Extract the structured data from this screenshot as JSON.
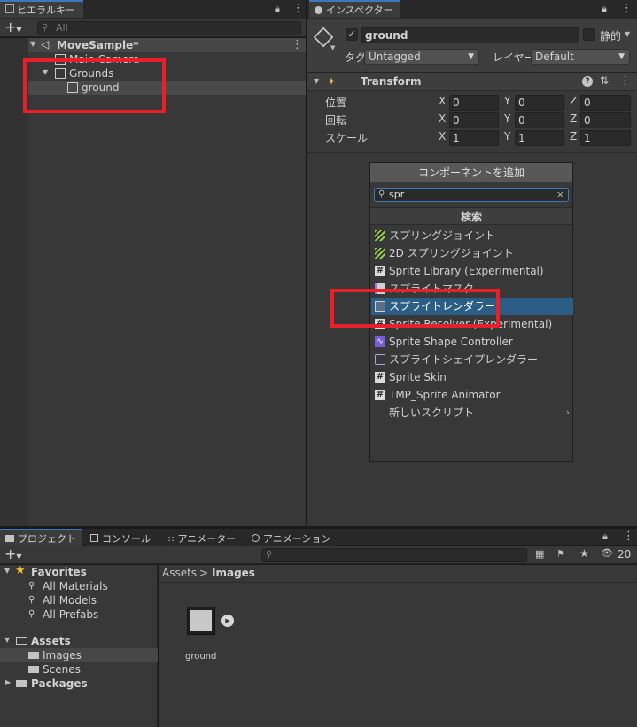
{
  "hierarchy": {
    "tab_label": "ヒエラルキー",
    "search_placeholder": "All",
    "scene_name": "MoveSample*",
    "items": [
      {
        "label": "Main Camera"
      },
      {
        "label": "Grounds"
      },
      {
        "label": "ground"
      }
    ]
  },
  "inspector": {
    "tab_label": "インスペクター",
    "object_name": "ground",
    "static_label": "静的",
    "tag_label": "タグ",
    "tag_value": "Untagged",
    "layer_label": "レイヤー",
    "layer_value": "Default",
    "transform": {
      "title": "Transform",
      "rows": [
        {
          "label": "位置",
          "x": "0",
          "y": "0",
          "z": "0"
        },
        {
          "label": "回転",
          "x": "0",
          "y": "0",
          "z": "0"
        },
        {
          "label": "スケール",
          "x": "1",
          "y": "1",
          "z": "1"
        }
      ],
      "axis_x": "X",
      "axis_y": "Y",
      "axis_z": "Z"
    },
    "add_component_label": "コンポーネントを追加",
    "popup": {
      "search_value": "spr",
      "header": "検索",
      "items": [
        {
          "label": "スプリングジョイント",
          "icon": "spring-joint-icon"
        },
        {
          "label": "2D スプリングジョイント",
          "icon": "spring-joint-2d-icon"
        },
        {
          "label": "Sprite Library (Experimental)",
          "icon": "script-icon"
        },
        {
          "label": "スプライトマスク",
          "icon": "sprite-mask-icon"
        },
        {
          "label": "スプライトレンダラー",
          "icon": "sprite-renderer-icon",
          "selected": true
        },
        {
          "label": "Sprite Resolver (Experimental)",
          "icon": "script-icon"
        },
        {
          "label": "Sprite Shape Controller",
          "icon": "sprite-shape-icon"
        },
        {
          "label": "スプライトシェイプレンダラー",
          "icon": "sprite-shape-renderer-icon"
        },
        {
          "label": "Sprite Skin",
          "icon": "script-icon"
        },
        {
          "label": "TMP_Sprite Animator",
          "icon": "script-icon"
        },
        {
          "label": "新しいスクリプト",
          "icon": "",
          "submenu": true
        }
      ]
    }
  },
  "bottom": {
    "tabs": [
      {
        "label": "プロジェクト",
        "icon": "folder-icon"
      },
      {
        "label": "コンソール",
        "icon": "console-icon"
      },
      {
        "label": "アニメーター",
        "icon": "animator-icon"
      },
      {
        "label": "アニメーション",
        "icon": "animation-icon"
      }
    ],
    "hidden_count": "20",
    "favorites": {
      "label": "Favorites",
      "items": [
        {
          "label": "All Materials"
        },
        {
          "label": "All Models"
        },
        {
          "label": "All Prefabs"
        }
      ]
    },
    "assets": {
      "label": "Assets",
      "items": [
        {
          "label": "Images"
        },
        {
          "label": "Scenes"
        }
      ]
    },
    "packages_label": "Packages",
    "breadcrumb": {
      "root": "Assets",
      "sep": ">",
      "current": "Images"
    },
    "asset_items": [
      {
        "label": "ground"
      }
    ]
  },
  "colors": {
    "accent": "#3a79bb",
    "selection": "#2c5d87",
    "highlight_red": "#e8202a",
    "background": "#383838"
  }
}
